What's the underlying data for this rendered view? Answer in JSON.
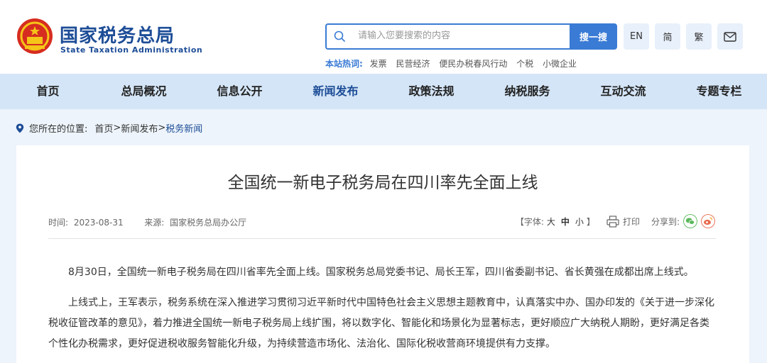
{
  "header": {
    "logo_cn": "国家税务总局",
    "logo_en": "State Taxation Administration",
    "search_placeholder": "请输入您要搜索的内容",
    "search_button": "搜一搜",
    "lang_en": "EN",
    "lang_simplified": "简",
    "lang_traditional": "繁",
    "hot_label": "本站热词:",
    "hot_words": [
      "发票",
      "民营经济",
      "便民办税春风行动",
      "个税",
      "小微企业"
    ]
  },
  "nav": {
    "items": [
      "首页",
      "总局概况",
      "信息公开",
      "新闻发布",
      "政策法规",
      "纳税服务",
      "互动交流",
      "专题专栏"
    ],
    "active": "新闻发布"
  },
  "breadcrumb": {
    "prefix": "您所在的位置:",
    "home": "首页",
    "sep1": ">",
    "level1": "新闻发布",
    "sep2": ">",
    "current": "税务新闻"
  },
  "article": {
    "title": "全国统一新电子税务局在四川率先全面上线",
    "time_label": "时间:",
    "time": "2023-08-31",
    "source_label": "来源:",
    "source": "国家税务总局办公厅",
    "font_open": "【字体:",
    "font_large": "大",
    "font_medium": "中",
    "font_small": "小",
    "font_close": "】",
    "print": "打印",
    "share": "分享到:",
    "paragraphs": [
      "8月30日，全国统一新电子税务局在四川省率先全面上线。国家税务总局党委书记、局长王军，四川省委副书记、省长黄强在成都出席上线式。",
      "上线式上，王军表示，税务系统在深入推进学习贯彻习近平新时代中国特色社会主义思想主题教育中，认真落实中办、国办印发的《关于进一步深化税收征管改革的意见》，着力推进全国统一新电子税务局上线扩围，将以数字化、智能化和场景化为显著标志，更好顺应广大纳税人期盼，更好满足各类个性化办税需求，更好促进税收服务智能化升级，为持续营造市场化、法治化、国际化税收营商环境提供有力支撑。"
    ]
  },
  "colors": {
    "brand": "#1d4d97",
    "accent": "#3a7bd5",
    "nav_bg": "#d4e5f7",
    "page_bg": "#edf4fb",
    "wechat": "#5cb85c",
    "weibo": "#e86a4e"
  }
}
